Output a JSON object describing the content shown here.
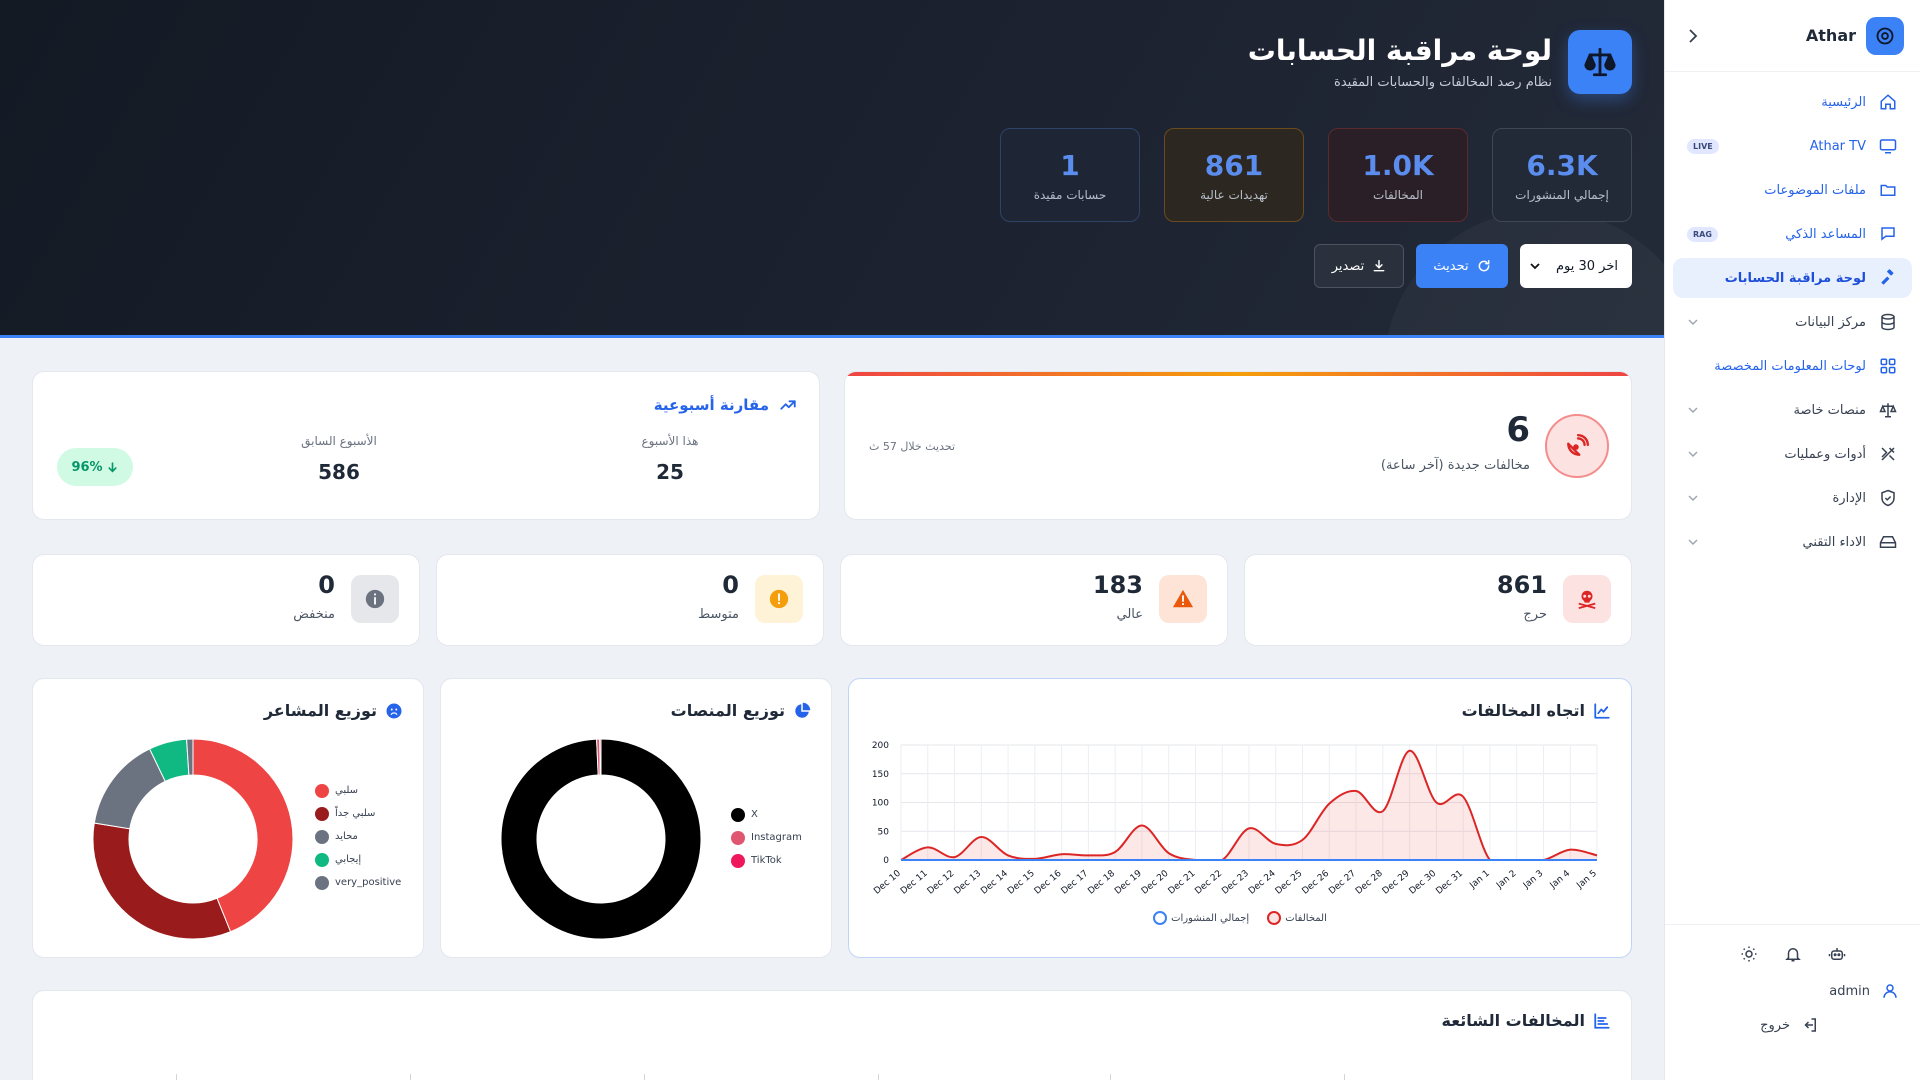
{
  "sidebar": {
    "brand": "Athar",
    "items": [
      {
        "label": "الرئيسية",
        "icon": "home-icon"
      },
      {
        "label": "Athar TV",
        "icon": "tv-icon",
        "badge": "LIVE"
      },
      {
        "label": "ملفات الموضوعات",
        "icon": "folder-icon"
      },
      {
        "label": "المساعد الذكي",
        "icon": "chat-icon",
        "badge": "RAG"
      },
      {
        "label": "لوحة مراقبة الحسابات",
        "icon": "gavel-icon",
        "active": true
      },
      {
        "label": "مركز البيانات",
        "icon": "database-icon",
        "expandable": true
      },
      {
        "label": "لوحات المعلومات المخصصة",
        "icon": "grid-icon"
      },
      {
        "label": "منصات خاصة",
        "icon": "scale-icon",
        "expandable": true
      },
      {
        "label": "أدوات وعمليات",
        "icon": "tools-icon",
        "expandable": true
      },
      {
        "label": "الإدارة",
        "icon": "shield-icon",
        "expandable": true
      },
      {
        "label": "الاداء التقني",
        "icon": "harddrive-icon",
        "expandable": true
      }
    ],
    "user": "admin",
    "logout": "خروج"
  },
  "header": {
    "title": "لوحة مراقبة الحسابات",
    "subtitle": "نظام رصد المخالفات والحسابات المقيدة",
    "stats": [
      {
        "value": "6.3K",
        "label": "إجمالي المنشورات"
      },
      {
        "value": "1.0K",
        "label": "المخالفات"
      },
      {
        "value": "861",
        "label": "تهديدات عالية"
      },
      {
        "value": "1",
        "label": "حسابات مقيدة"
      }
    ],
    "period": "اخر 30 يوم",
    "refresh": "تحديث",
    "export": "تصدير"
  },
  "new_violations": {
    "count": "6",
    "label": "مخالفات جديدة (آخر ساعة)",
    "updated": "تحديث خلال 57 ث"
  },
  "weekly": {
    "title": "مقارنة أسبوعية",
    "this_week_label": "هذا الأسبوع",
    "this_week": "25",
    "prev_week_label": "الأسبوع السابق",
    "prev_week": "586",
    "change": "96%"
  },
  "severity": [
    {
      "value": "861",
      "label": "حرج",
      "color": "#dc2626"
    },
    {
      "value": "183",
      "label": "عالي",
      "color": "#ea580c"
    },
    {
      "value": "0",
      "label": "متوسط",
      "color": "#f59e0b"
    },
    {
      "value": "0",
      "label": "منخفض",
      "color": "#6b7280"
    }
  ],
  "trend": {
    "title": "اتجاه المخالفات",
    "legend": [
      "المخالفات",
      "إجمالي المنشورات"
    ]
  },
  "platforms": {
    "title": "توزيع المنصات",
    "legend": [
      "X",
      "Instagram",
      "TikTok"
    ]
  },
  "sentiment": {
    "title": "توزيع المشاعر",
    "legend": [
      "سلبي",
      "سلبي جداً",
      "محايد",
      "إيجابي",
      "very_positive"
    ]
  },
  "common": {
    "title": "المخالفات الشائعة"
  },
  "chart_data": [
    {
      "type": "area",
      "title": "اتجاه المخالفات",
      "categories": [
        "Dec 10",
        "Dec 11",
        "Dec 12",
        "Dec 13",
        "Dec 14",
        "Dec 15",
        "Dec 16",
        "Dec 17",
        "Dec 18",
        "Dec 19",
        "Dec 20",
        "Dec 21",
        "Dec 22",
        "Dec 23",
        "Dec 24",
        "Dec 25",
        "Dec 26",
        "Dec 27",
        "Dec 28",
        "Dec 29",
        "Dec 30",
        "Dec 31",
        "Jan 1",
        "Jan 2",
        "Jan 3",
        "Jan 4",
        "Jan 5"
      ],
      "series": [
        {
          "name": "المخالفات",
          "color": "#dc2626",
          "values": [
            0,
            22,
            5,
            40,
            8,
            2,
            10,
            8,
            14,
            60,
            12,
            0,
            0,
            55,
            28,
            35,
            98,
            120,
            85,
            190,
            100,
            110,
            0,
            0,
            0,
            18,
            8
          ]
        },
        {
          "name": "إجمالي المنشورات",
          "color": "#3b82f6",
          "values": []
        }
      ],
      "ylim": [
        0,
        200
      ],
      "yticks": [
        0,
        50,
        100,
        150,
        200
      ],
      "grid": true,
      "legend": "bottom"
    },
    {
      "type": "pie",
      "title": "توزيع المنصات",
      "labels": [
        "X",
        "Instagram",
        "TikTok"
      ],
      "values": [
        99.3,
        0.5,
        0.2
      ],
      "colors": [
        "#000000",
        "#e05570",
        "#f0185c"
      ]
    },
    {
      "type": "pie",
      "title": "توزيع المشاعر",
      "labels": [
        "سلبي",
        "سلبي جداً",
        "محايد",
        "إيجابي",
        "very_positive"
      ],
      "values": [
        43,
        33,
        15,
        6,
        1
      ],
      "colors": [
        "#ef4444",
        "#991b1b",
        "#6b7280",
        "#10b981",
        "#6b7280"
      ]
    }
  ]
}
